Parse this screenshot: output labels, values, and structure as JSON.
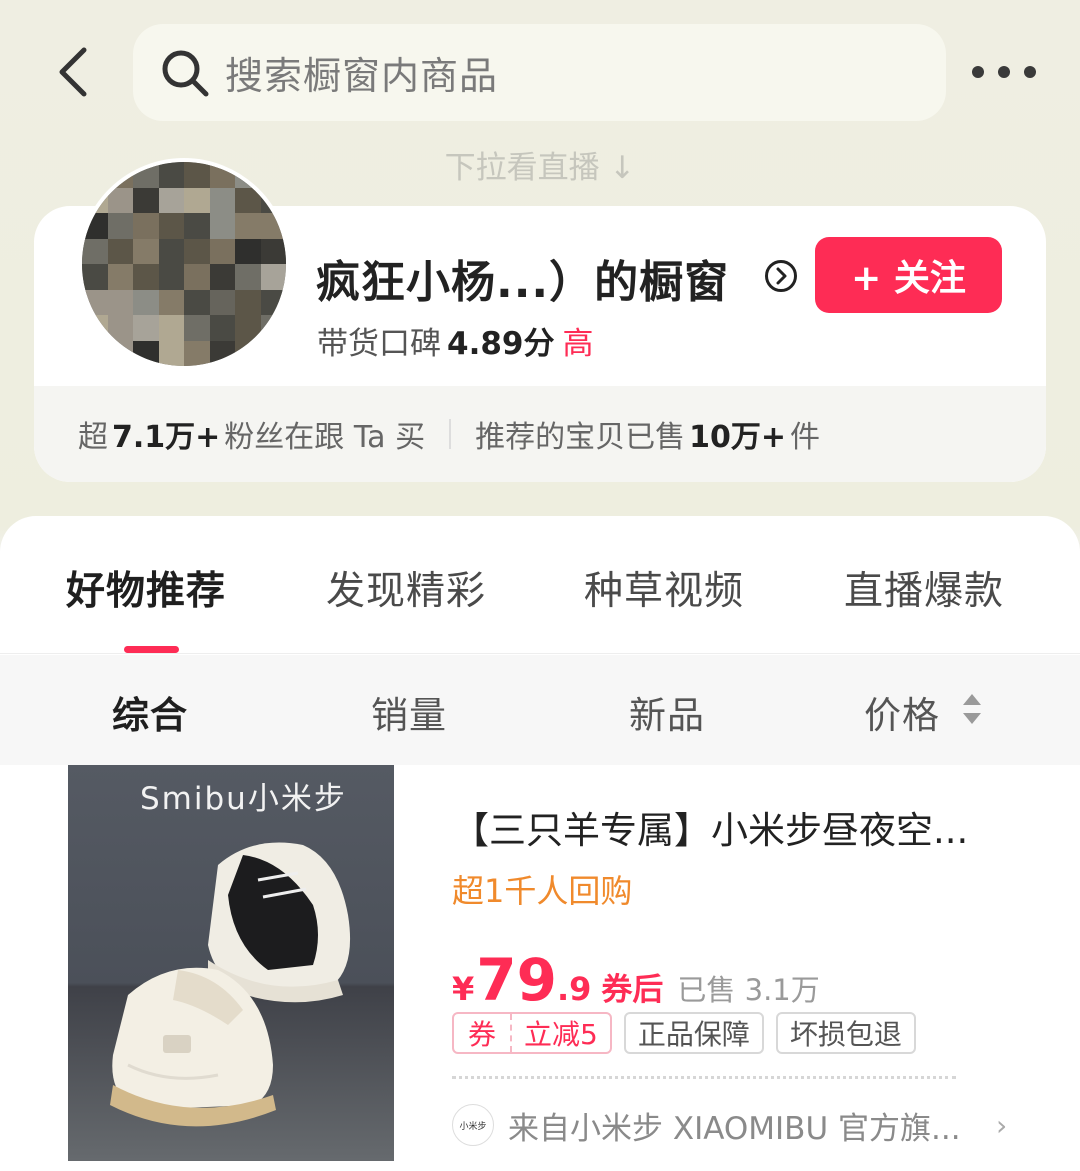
{
  "topbar": {
    "back_icon": "chevron-left-icon",
    "search_placeholder": "搜索橱窗内商品",
    "more_icon": "more-dots-icon"
  },
  "pull_hint": "下拉看直播 ↓",
  "shop": {
    "name": "疯狂小杨...）的橱窗",
    "rating_label": "带货口碑",
    "rating_value": "4.89分",
    "rating_level": "高",
    "follow_label": "+ 关注",
    "stats": {
      "fans_prefix": "超",
      "fans_value": "7.1万+",
      "fans_suffix": "粉丝在跟 Ta 买",
      "sold_prefix": "推荐的宝贝已售",
      "sold_value": "10万+",
      "sold_suffix": "件"
    }
  },
  "tabs": [
    {
      "label": "好物推荐",
      "active": true
    },
    {
      "label": "发现精彩",
      "active": false
    },
    {
      "label": "种草视频",
      "active": false
    },
    {
      "label": "直播爆款",
      "active": false
    }
  ],
  "sorts": [
    {
      "label": "综合",
      "active": true
    },
    {
      "label": "销量",
      "active": false
    },
    {
      "label": "新品",
      "active": false
    },
    {
      "label": "价格",
      "active": false
    }
  ],
  "product": {
    "image_brand_text": "Smibu小米步",
    "title": "【三只羊专属】小米步昼夜空...",
    "rebuy": "超1千人回购",
    "price_currency": "¥",
    "price_int": "79",
    "price_dec": ".9",
    "price_note": "券后",
    "sold": "已售 3.1万",
    "coupon_label": "券",
    "coupon_value": "立减5",
    "tags": [
      "正品保障",
      "坏损包退"
    ],
    "from_text": "来自小米步 XIAOMIBU 官方旗...",
    "store_logo_text": "小米步"
  },
  "colors": {
    "accent": "#fe2c55",
    "rebuy": "#f08a2c"
  }
}
